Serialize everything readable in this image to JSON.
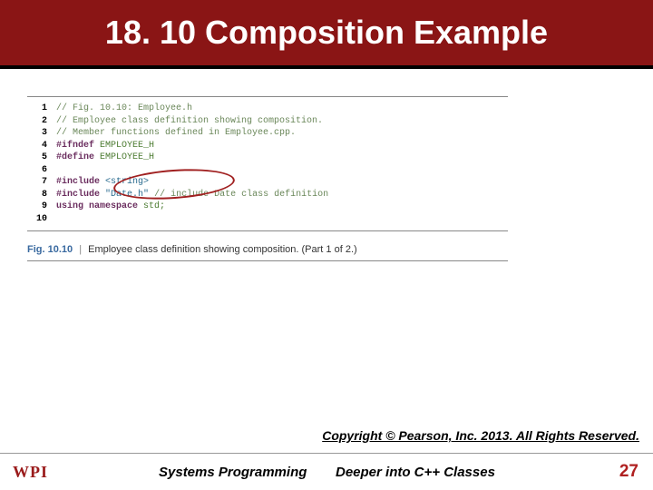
{
  "title": "18. 10 Composition Example",
  "code": {
    "lines": [
      {
        "n": "1",
        "comment": "// Fig. 10.10: Employee.h"
      },
      {
        "n": "2",
        "comment": "// Employee class definition showing composition."
      },
      {
        "n": "3",
        "comment": "// Member functions defined in Employee.cpp."
      },
      {
        "n": "4",
        "directive": "#ifndef",
        "ident": "EMPLOYEE_H"
      },
      {
        "n": "5",
        "directive": "#define",
        "ident": "EMPLOYEE_H"
      },
      {
        "n": "6"
      },
      {
        "n": "7",
        "directive": "#include",
        "string": "<string>"
      },
      {
        "n": "8",
        "directive": "#include",
        "string": "\"Date.h\"",
        "trail_comment": "// include Date class definition"
      },
      {
        "n": "9",
        "kw": "using namespace",
        "ident2": "std;"
      },
      {
        "n": "10"
      }
    ]
  },
  "caption": {
    "label": "Fig. 10.10",
    "text": "Employee class definition showing composition. (Part 1 of 2.)"
  },
  "copyright": "Copyright © Pearson, Inc. 2013. All Rights Reserved.",
  "footer": {
    "left": "Systems Programming",
    "mid": "Deeper into C++ Classes",
    "page": "27",
    "logo": "WPI"
  }
}
